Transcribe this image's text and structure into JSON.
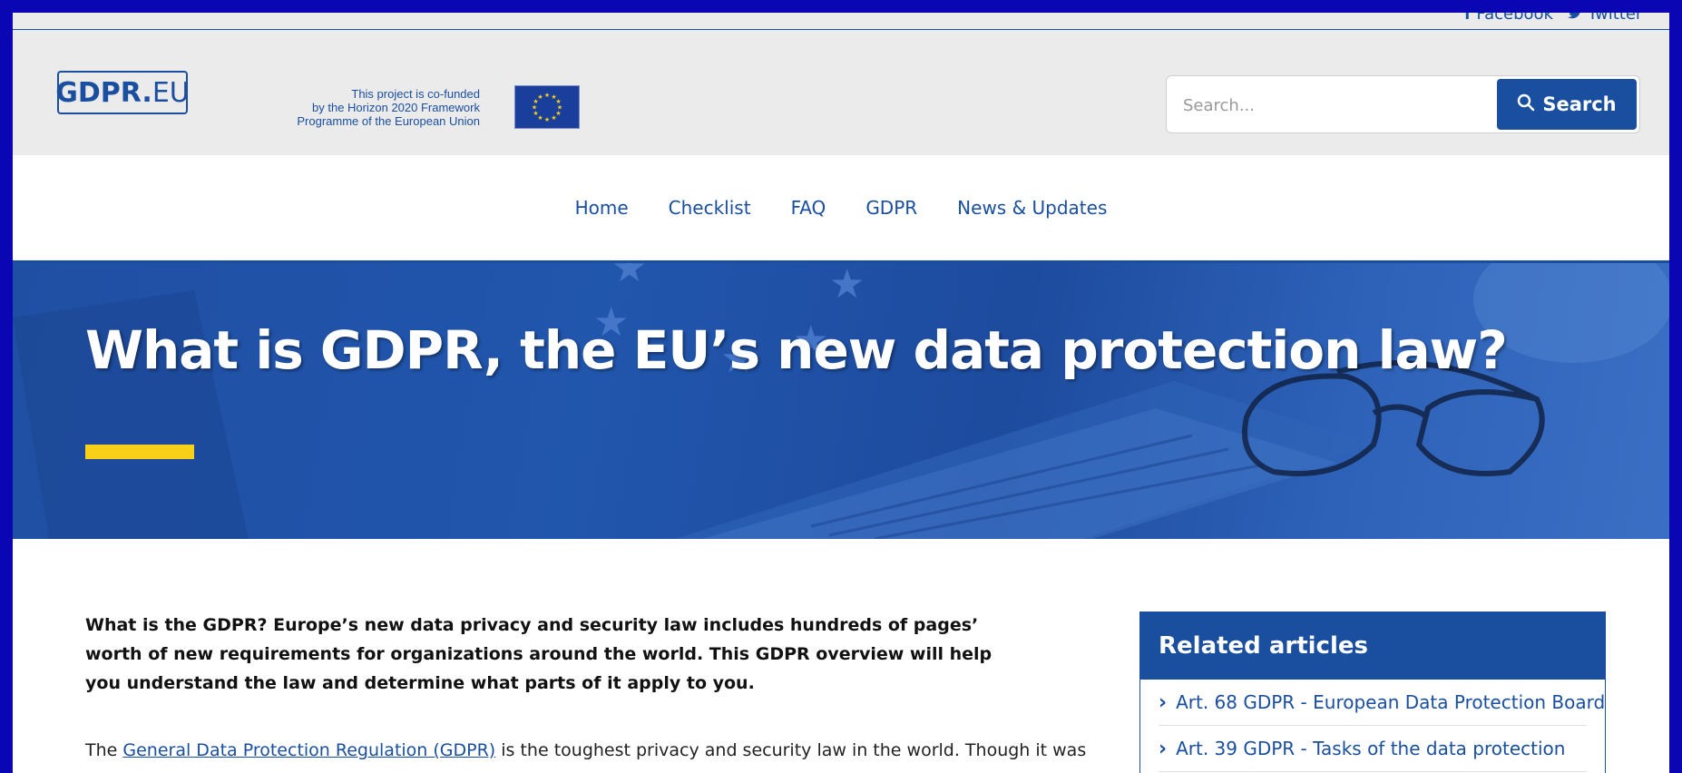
{
  "social": {
    "facebook_label": "Facebook",
    "twitter_label": "Twitter"
  },
  "header": {
    "logo_bold": "GDPR.",
    "logo_thin": "EU",
    "cofund_line1": "This project is co-funded",
    "cofund_line2": "by the Horizon 2020 Framework",
    "cofund_line3": "Programme of the European Union"
  },
  "search": {
    "placeholder": "Search...",
    "button_label": "Search"
  },
  "nav": {
    "items": [
      "Home",
      "Checklist",
      "FAQ",
      "GDPR",
      "News & Updates"
    ]
  },
  "hero": {
    "title": "What is GDPR, the EU’s new data protection law?"
  },
  "content": {
    "intro": "What is the GDPR? Europe’s new data privacy and security law includes hundreds of pages’ worth of new requirements for organizations around the world. This GDPR overview will help you understand the law and determine what parts of it apply to you.",
    "p2_prefix": "The ",
    "p2_link": "General Data Protection Regulation (GDPR)",
    "p2_suffix": " is the toughest privacy and security law in the world. Though it was"
  },
  "related": {
    "heading": "Related articles",
    "items": [
      "Art. 68 GDPR - European Data Protection Board",
      "Art. 39 GDPR - Tasks of the data protection"
    ]
  },
  "colors": {
    "brand_blue": "#1a4fa0",
    "accent_yellow": "#f7d117",
    "header_gray": "#ebebeb",
    "frame_blue": "#0a06b4"
  }
}
